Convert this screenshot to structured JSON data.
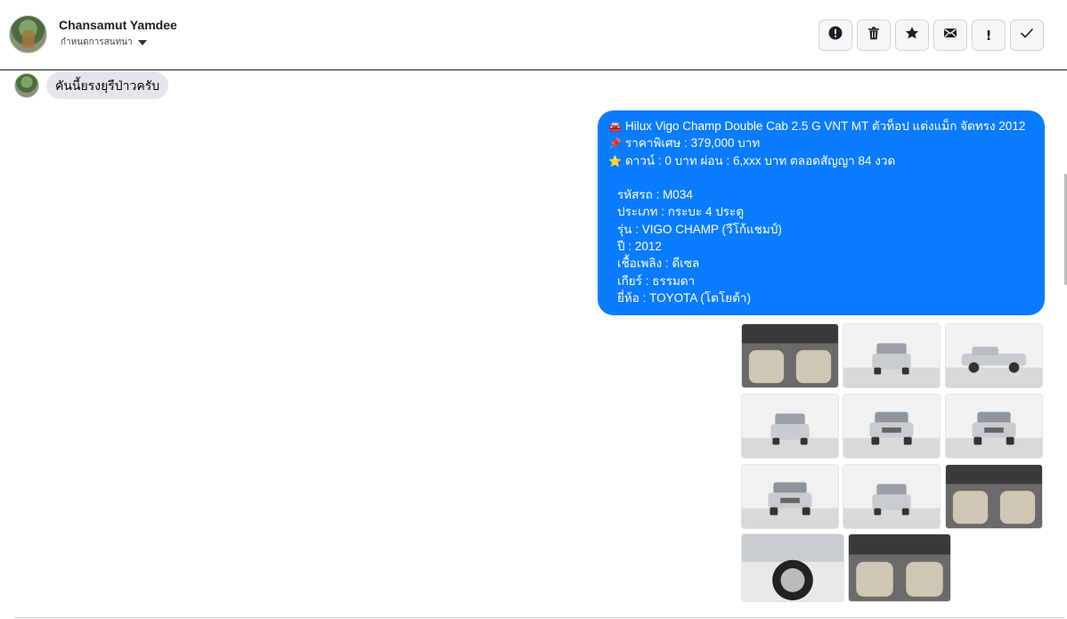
{
  "header": {
    "contact_name": "Chansamut Yamdee",
    "contact_sub": "กำหนดการสนทนา",
    "actions": [
      {
        "icon": "exclamation-circle-icon",
        "name": "mark-spam-button"
      },
      {
        "icon": "trash-icon",
        "name": "delete-button"
      },
      {
        "icon": "star-icon",
        "name": "star-button"
      },
      {
        "icon": "envelope-icon",
        "name": "mark-unread-button"
      },
      {
        "icon": "exclamation-icon",
        "name": "important-button"
      },
      {
        "icon": "check-icon",
        "name": "done-button"
      }
    ]
  },
  "incoming": {
    "text": "คันนี้ยรงยุรีป่าวครับ"
  },
  "outgoing": {
    "lines": [
      {
        "emoji": "🚘",
        "text": "Hilux Vigo Champ Double Cab 2.5 G VNT MT ตัวท็อป แต่งแม็ก จัดทรง 2012"
      },
      {
        "emoji": "📌",
        "text": "ราคาพิเศษ : 379,000 บาท"
      },
      {
        "emoji": "⭐",
        "text": "ดาวน์ : 0 บาท ผ่อน : 6,xxx บาท ตลอดสัญญา 84 งวด"
      }
    ],
    "specs": [
      "รหัสรถ : M034",
      "ประเภท : กระบะ 4 ประตู",
      "รุ่น : VIGO CHAMP (วีโก้แชมป์)",
      "ปี : 2012",
      "เชื้อเพลิง : ดีเซล",
      "เกียร์ : ธรรมดา",
      "ยี่ห้อ : TOYOTA (โตโยต้า)"
    ]
  },
  "photos": [
    {
      "kind": "interior-dash"
    },
    {
      "kind": "car-rear"
    },
    {
      "kind": "car-side"
    },
    {
      "kind": "car-rear-quarter"
    },
    {
      "kind": "car-front"
    },
    {
      "kind": "car-front-quarter"
    },
    {
      "kind": "car-front-quarter-left"
    },
    {
      "kind": "car-rear-open"
    },
    {
      "kind": "interior-rear-seats"
    },
    {
      "kind": "wheel-closeup"
    },
    {
      "kind": "interior-front-seats"
    }
  ],
  "colors": {
    "bubble_out": "#0a7cff",
    "bubble_in": "#e4e6eb",
    "car_body": "#c9cccf"
  }
}
